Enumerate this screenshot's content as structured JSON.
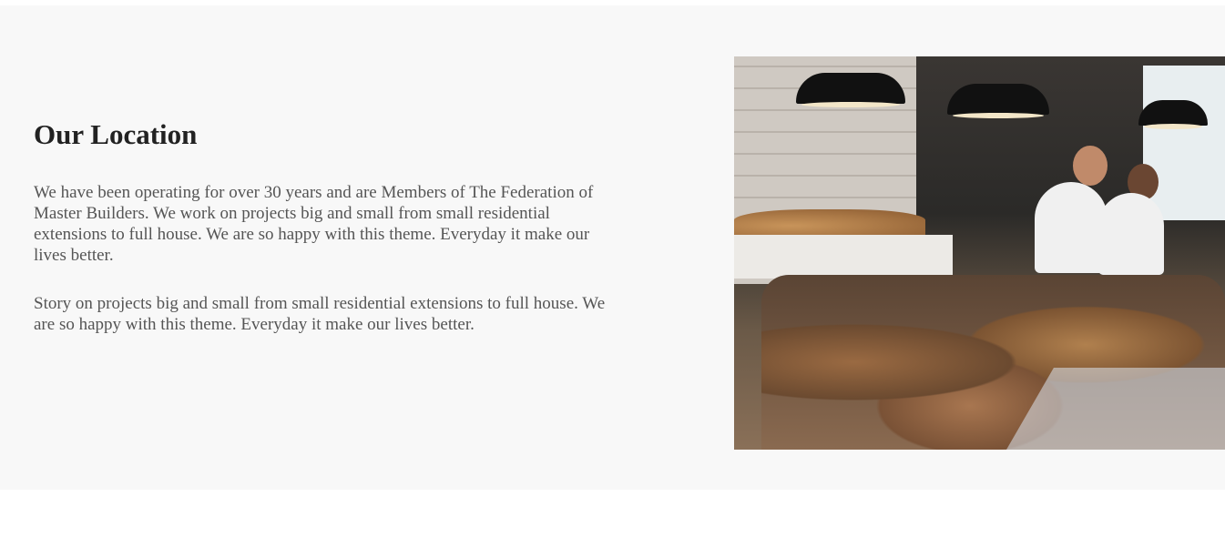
{
  "location": {
    "title": "Our Location",
    "paragraphs": [
      "We have been operating for over 30 years and are Members of The Federation of Master Builders. We work on projects big and small from small residential extensions to full house. We are so happy with this theme. Everyday it make our lives better.",
      "Story on projects big and small from small residential extensions to full house. We are so happy with this theme. Everyday it make our lives better."
    ]
  },
  "colors": {
    "section_bg": "#f8f8f8",
    "title": "#222222",
    "text": "#555555"
  }
}
